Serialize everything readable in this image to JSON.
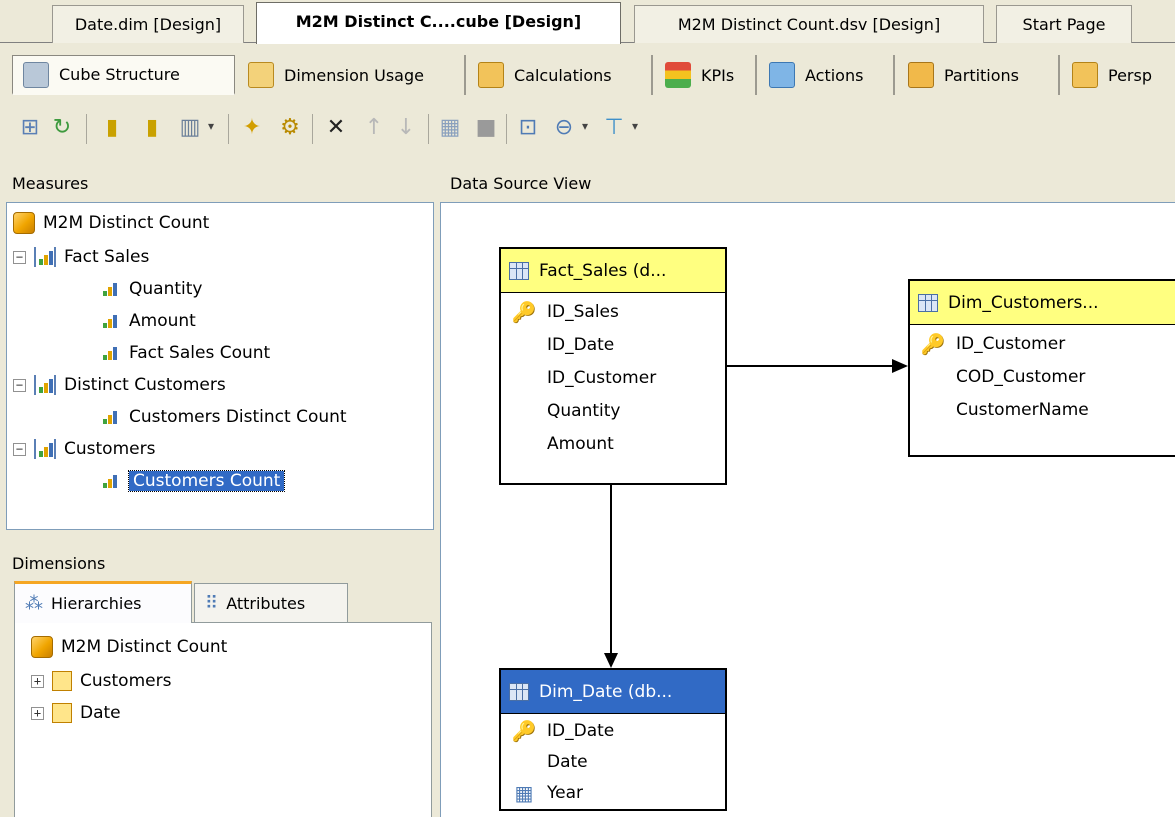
{
  "doc_tabs": [
    "Date.dim [Design]",
    "M2M Distinct C....cube [Design]",
    "M2M Distinct Count.dsv [Design]",
    "Start Page"
  ],
  "designer_tabs": [
    "Cube Structure",
    "Dimension Usage",
    "Calculations",
    "KPIs",
    "Actions",
    "Partitions",
    "Persp"
  ],
  "measures": {
    "header": "Measures",
    "root": "M2M Distinct Count",
    "groups": [
      {
        "name": "Fact Sales",
        "items": [
          "Quantity",
          "Amount",
          "Fact Sales Count"
        ]
      },
      {
        "name": "Distinct Customers",
        "items": [
          "Customers Distinct Count"
        ]
      },
      {
        "name": "Customers",
        "items": [
          "Customers Count"
        ]
      }
    ],
    "selected": "Customers Count"
  },
  "dimensions": {
    "header": "Dimensions",
    "tabs": [
      "Hierarchies",
      "Attributes"
    ],
    "root": "M2M Distinct Count",
    "items": [
      "Customers",
      "Date"
    ],
    "expander": "+"
  },
  "dsv": {
    "header": "Data Source View",
    "tables": {
      "fact_sales": {
        "title": "Fact_Sales (d...",
        "columns": [
          "ID_Sales",
          "ID_Date",
          "ID_Customer",
          "Quantity",
          "Amount"
        ]
      },
      "dim_customers": {
        "title": "Dim_Customers...",
        "columns": [
          "ID_Customer",
          "COD_Customer",
          "CustomerName"
        ]
      },
      "dim_date": {
        "title": "Dim_Date (db...",
        "columns": [
          "ID_Date",
          "Date",
          "Year"
        ]
      }
    }
  },
  "icons": {
    "collapse": "−",
    "dropdown": "▾"
  },
  "colors": {
    "selection": "#316ac5",
    "table_header_yellow": "#ffff80",
    "pane_border": "#7f9db9"
  }
}
